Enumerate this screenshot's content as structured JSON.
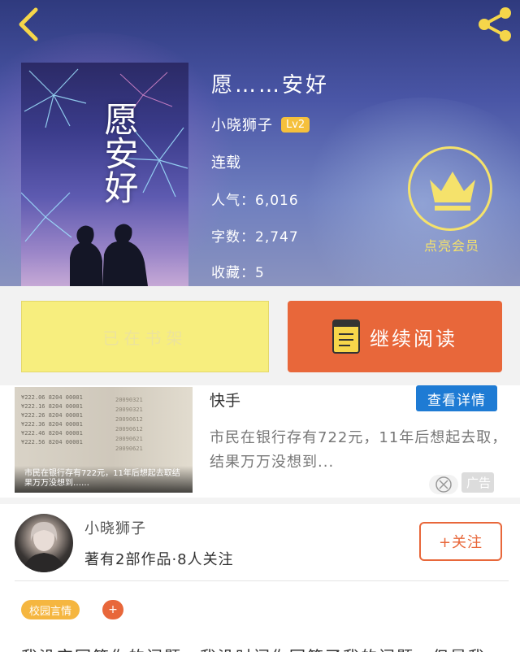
{
  "book": {
    "title": "愿……安好",
    "cover_title": "愿安好",
    "author": "小晓狮子",
    "level": "Lv2",
    "status": "连载",
    "popularity": "人气：6,016",
    "word_count": "字数：2,747",
    "favorites": "收藏：5"
  },
  "vip": {
    "label": "点亮会员"
  },
  "actions": {
    "shelf_label": "已在书架",
    "read_label": "继续阅读"
  },
  "ad": {
    "source": "快手",
    "detail_label": "查看详情",
    "description": "市民在银行存有722元，11年后想起去取，结果万万没想到...",
    "caption": "市民在银行存有722元，11年后想起去取结果万万没想到……",
    "ad_label": "广告",
    "thumb_rows": [
      "¥222.06 8204 00001",
      "¥222.16 8204 00001",
      "¥222.26 8204 00001",
      "¥222.36 8204 00001",
      "¥222.46 8204 00001",
      "¥222.56 8204 00001"
    ],
    "thumb_rows2": [
      "20090321",
      "20090321",
      "20090612",
      "20090612",
      "20090621",
      "20090621"
    ]
  },
  "author_section": {
    "name": "小晓狮子",
    "meta": "著有2部作品·8人关注",
    "follow_label": "+关注"
  },
  "tags": {
    "first": "校园言情",
    "add": "+"
  },
  "intro": {
    "text": "我没空回答你的问题，我没时间你回答了我的问题，但是我"
  },
  "colors": {
    "accent": "#e8673a",
    "shelf": "#f7ee7e",
    "vip": "#f5e26b",
    "ad_button": "#1e7bd4",
    "tag": "#f5b640"
  }
}
